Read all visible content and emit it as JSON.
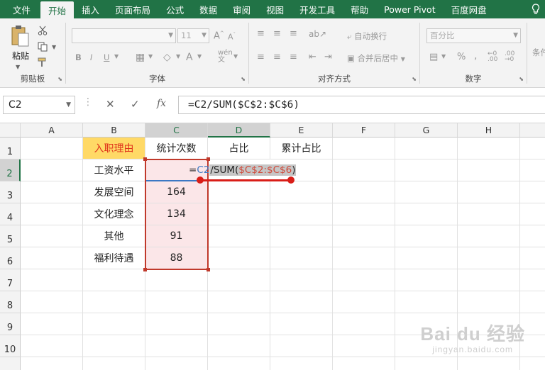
{
  "tabs": [
    "文件",
    "开始",
    "插入",
    "页面布局",
    "公式",
    "数据",
    "审阅",
    "视图",
    "开发工具",
    "帮助",
    "Power Pivot",
    "百度网盘"
  ],
  "active_tab_index": 1,
  "colors": {
    "accent": "#217346",
    "header_fill": "#ffd966",
    "header_text": "#e0321b",
    "range_fill": "#fbe6e8",
    "annotation": "#d91e18"
  },
  "ribbon": {
    "groups": {
      "clipboard": "剪贴板",
      "font": "字体",
      "alignment": "对齐方式",
      "number": "数字"
    },
    "paste_label": "粘贴",
    "font_size": "11",
    "wrap_text": "自动换行",
    "merge_center": "合并后居中",
    "number_format": "百分比",
    "conditional": "条件"
  },
  "formula_bar": {
    "name_box": "C2",
    "formula": "=C2/SUM($C$2:$C$6)"
  },
  "columns": [
    "A",
    "B",
    "C",
    "D",
    "E",
    "F",
    "G",
    "H"
  ],
  "rows": [
    "1",
    "2",
    "3",
    "4",
    "5",
    "6",
    "7",
    "8",
    "9",
    "10"
  ],
  "table": {
    "headers": [
      "入职理由",
      "统计次数",
      "占比",
      "累计占比"
    ],
    "reasons": [
      "工资水平",
      "发展空间",
      "文化理念",
      "其他",
      "福利待遇"
    ],
    "counts": [
      "",
      "164",
      "134",
      "91",
      "88"
    ]
  },
  "edit_cell": {
    "eq": "=",
    "ref1": "C2",
    "slash": "/",
    "sum_open": "SUM(",
    "ref2": "$C$2:$C$6",
    "close": ")"
  },
  "watermark": {
    "main": "Bai du 经验",
    "sub": "jingyan.baidu.com"
  }
}
